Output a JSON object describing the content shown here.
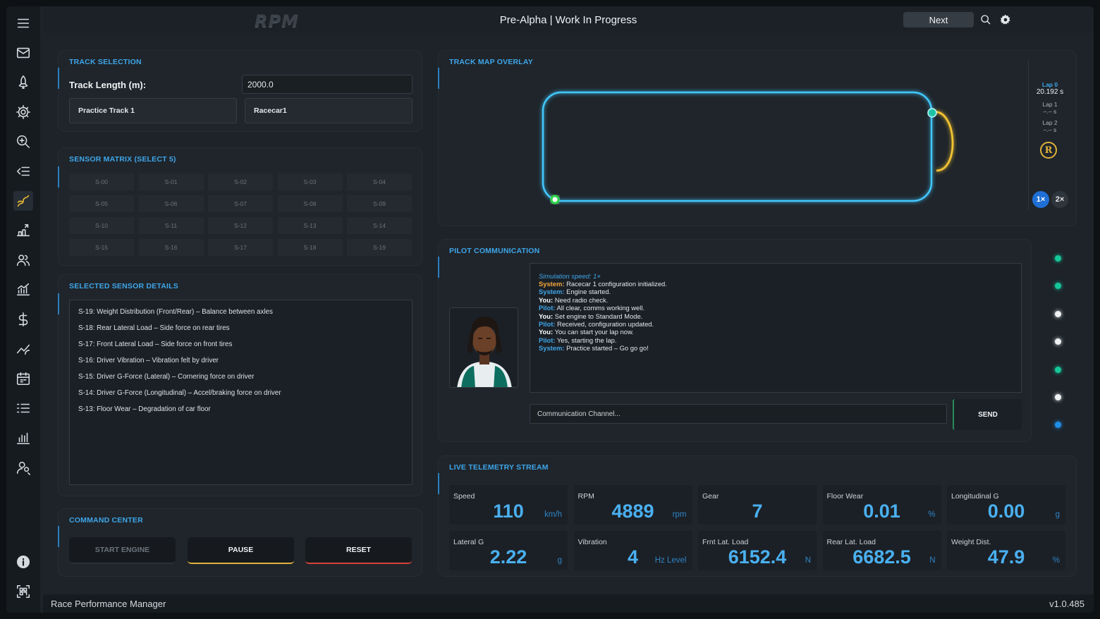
{
  "header": {
    "logo": "RPM",
    "title": "Pre-Alpha | Work In Progress",
    "next_label": "Next"
  },
  "sidebar": {
    "icons": [
      "menu-icon",
      "mail-icon",
      "rocket-icon",
      "gear-icon",
      "zoom-search-icon",
      "collapse-list-icon",
      "route-icon",
      "growth-icon",
      "team-icon",
      "analytics-icon",
      "dollar-icon",
      "trend-icon",
      "calendar-icon",
      "checklist-icon",
      "bar-chart-icon",
      "user-search-icon"
    ],
    "active_index": 6,
    "bottom_icons": [
      "info-icon",
      "scan-icon"
    ],
    "active_color": "#f2c233"
  },
  "track": {
    "title": "TRACK SELECTION",
    "length_label": "Track Length (m):",
    "length_value": "2000.0",
    "track_name": "Practice Track 1",
    "car_name": "Racecar1"
  },
  "sensors": {
    "title": "SENSOR MATRIX (SELECT 5)",
    "items": [
      "S-00",
      "S-01",
      "S-02",
      "S-03",
      "S-04",
      "S-05",
      "S-06",
      "S-07",
      "S-08",
      "S-09",
      "S-10",
      "S-11",
      "S-12",
      "S-13",
      "S-14",
      "S-15",
      "S-16",
      "S-17",
      "S-18",
      "S-19"
    ]
  },
  "details": {
    "title": "SELECTED SENSOR DETAILS",
    "items": [
      "S-19: Weight Distribution (Front/Rear) – Balance between axles",
      "S-18: Rear Lateral Load – Side force on rear tires",
      "S-17: Front Lateral Load – Side force on front tires",
      "S-16: Driver Vibration – Vibration felt by driver",
      "S-15: Driver G-Force (Lateral) – Cornering force on driver",
      "S-14: Driver G-Force (Longitudinal) – Accel/braking force on driver",
      "S-13: Floor Wear – Degradation of car floor"
    ]
  },
  "command": {
    "title": "COMMAND CENTER",
    "start_label": "START ENGINE",
    "pause_label": "PAUSE",
    "reset_label": "RESET",
    "pause_color": "#e0b23a",
    "reset_color": "#d8433a"
  },
  "map": {
    "title": "TRACK MAP OVERLAY",
    "laps": [
      {
        "label": "Lap 0",
        "time": "20.192 s"
      },
      {
        "label": "Lap 1",
        "time": "–.– s"
      },
      {
        "label": "Lap 2",
        "time": "–.– s"
      }
    ],
    "badge": "R",
    "speed_1x": "1×",
    "speed_2x": "2×",
    "track_color": "#43c8ff",
    "segment_color": "#f2c233"
  },
  "comms": {
    "title": "PILOT COMMUNICATION",
    "speed_note": "Simulation speed: 1×",
    "messages": [
      {
        "speaker": "System:",
        "text": " Racecar 1 configuration initialized.",
        "role": "sys"
      },
      {
        "speaker": "System:",
        "text": " Engine started.",
        "role": "pil"
      },
      {
        "speaker": "You:",
        "text": " Need radio check.",
        "role": "you"
      },
      {
        "speaker": "Pilot:",
        "text": " All clear, comms working well.",
        "role": "pil"
      },
      {
        "speaker": "You:",
        "text": " Set engine to Standard Mode.",
        "role": "you"
      },
      {
        "speaker": "Pilot:",
        "text": " Received, configuration updated.",
        "role": "pil"
      },
      {
        "speaker": "You:",
        "text": " You can start your lap now.",
        "role": "you"
      },
      {
        "speaker": "Pilot:",
        "text": " Yes, starting the lap.",
        "role": "pil"
      },
      {
        "speaker": "System:",
        "text": " Practice started – Go go go!",
        "role": "pil"
      }
    ],
    "placeholder": "Communication Channel...",
    "send_label": "SEND",
    "status_colors": [
      "#16c79a",
      "#16c79a",
      "#eef0f2",
      "#eef0f2",
      "#16c79a",
      "#eef0f2",
      "#1f8fe8"
    ]
  },
  "telemetry": {
    "title": "LIVE TELEMETRY STREAM",
    "items": [
      {
        "label": "Speed",
        "value": "110",
        "unit": "km/h"
      },
      {
        "label": "RPM",
        "value": "4889",
        "unit": "rpm"
      },
      {
        "label": "Gear",
        "value": "7",
        "unit": ""
      },
      {
        "label": "Floor Wear",
        "value": "0.01",
        "unit": "%"
      },
      {
        "label": "Longitudinal G",
        "value": "0.00",
        "unit": "g"
      },
      {
        "label": "Lateral G",
        "value": "2.22",
        "unit": "g"
      },
      {
        "label": "Vibration",
        "value": "4",
        "unit": "Hz Level"
      },
      {
        "label": "Frnt Lat. Load",
        "value": "6152.4",
        "unit": "N"
      },
      {
        "label": "Rear Lat. Load",
        "value": "6682.5",
        "unit": "N"
      },
      {
        "label": "Weight Dist.",
        "value": "47.9",
        "unit": "%"
      }
    ]
  },
  "footer": {
    "app_name": "Race Performance Manager",
    "version": "v1.0.485"
  }
}
